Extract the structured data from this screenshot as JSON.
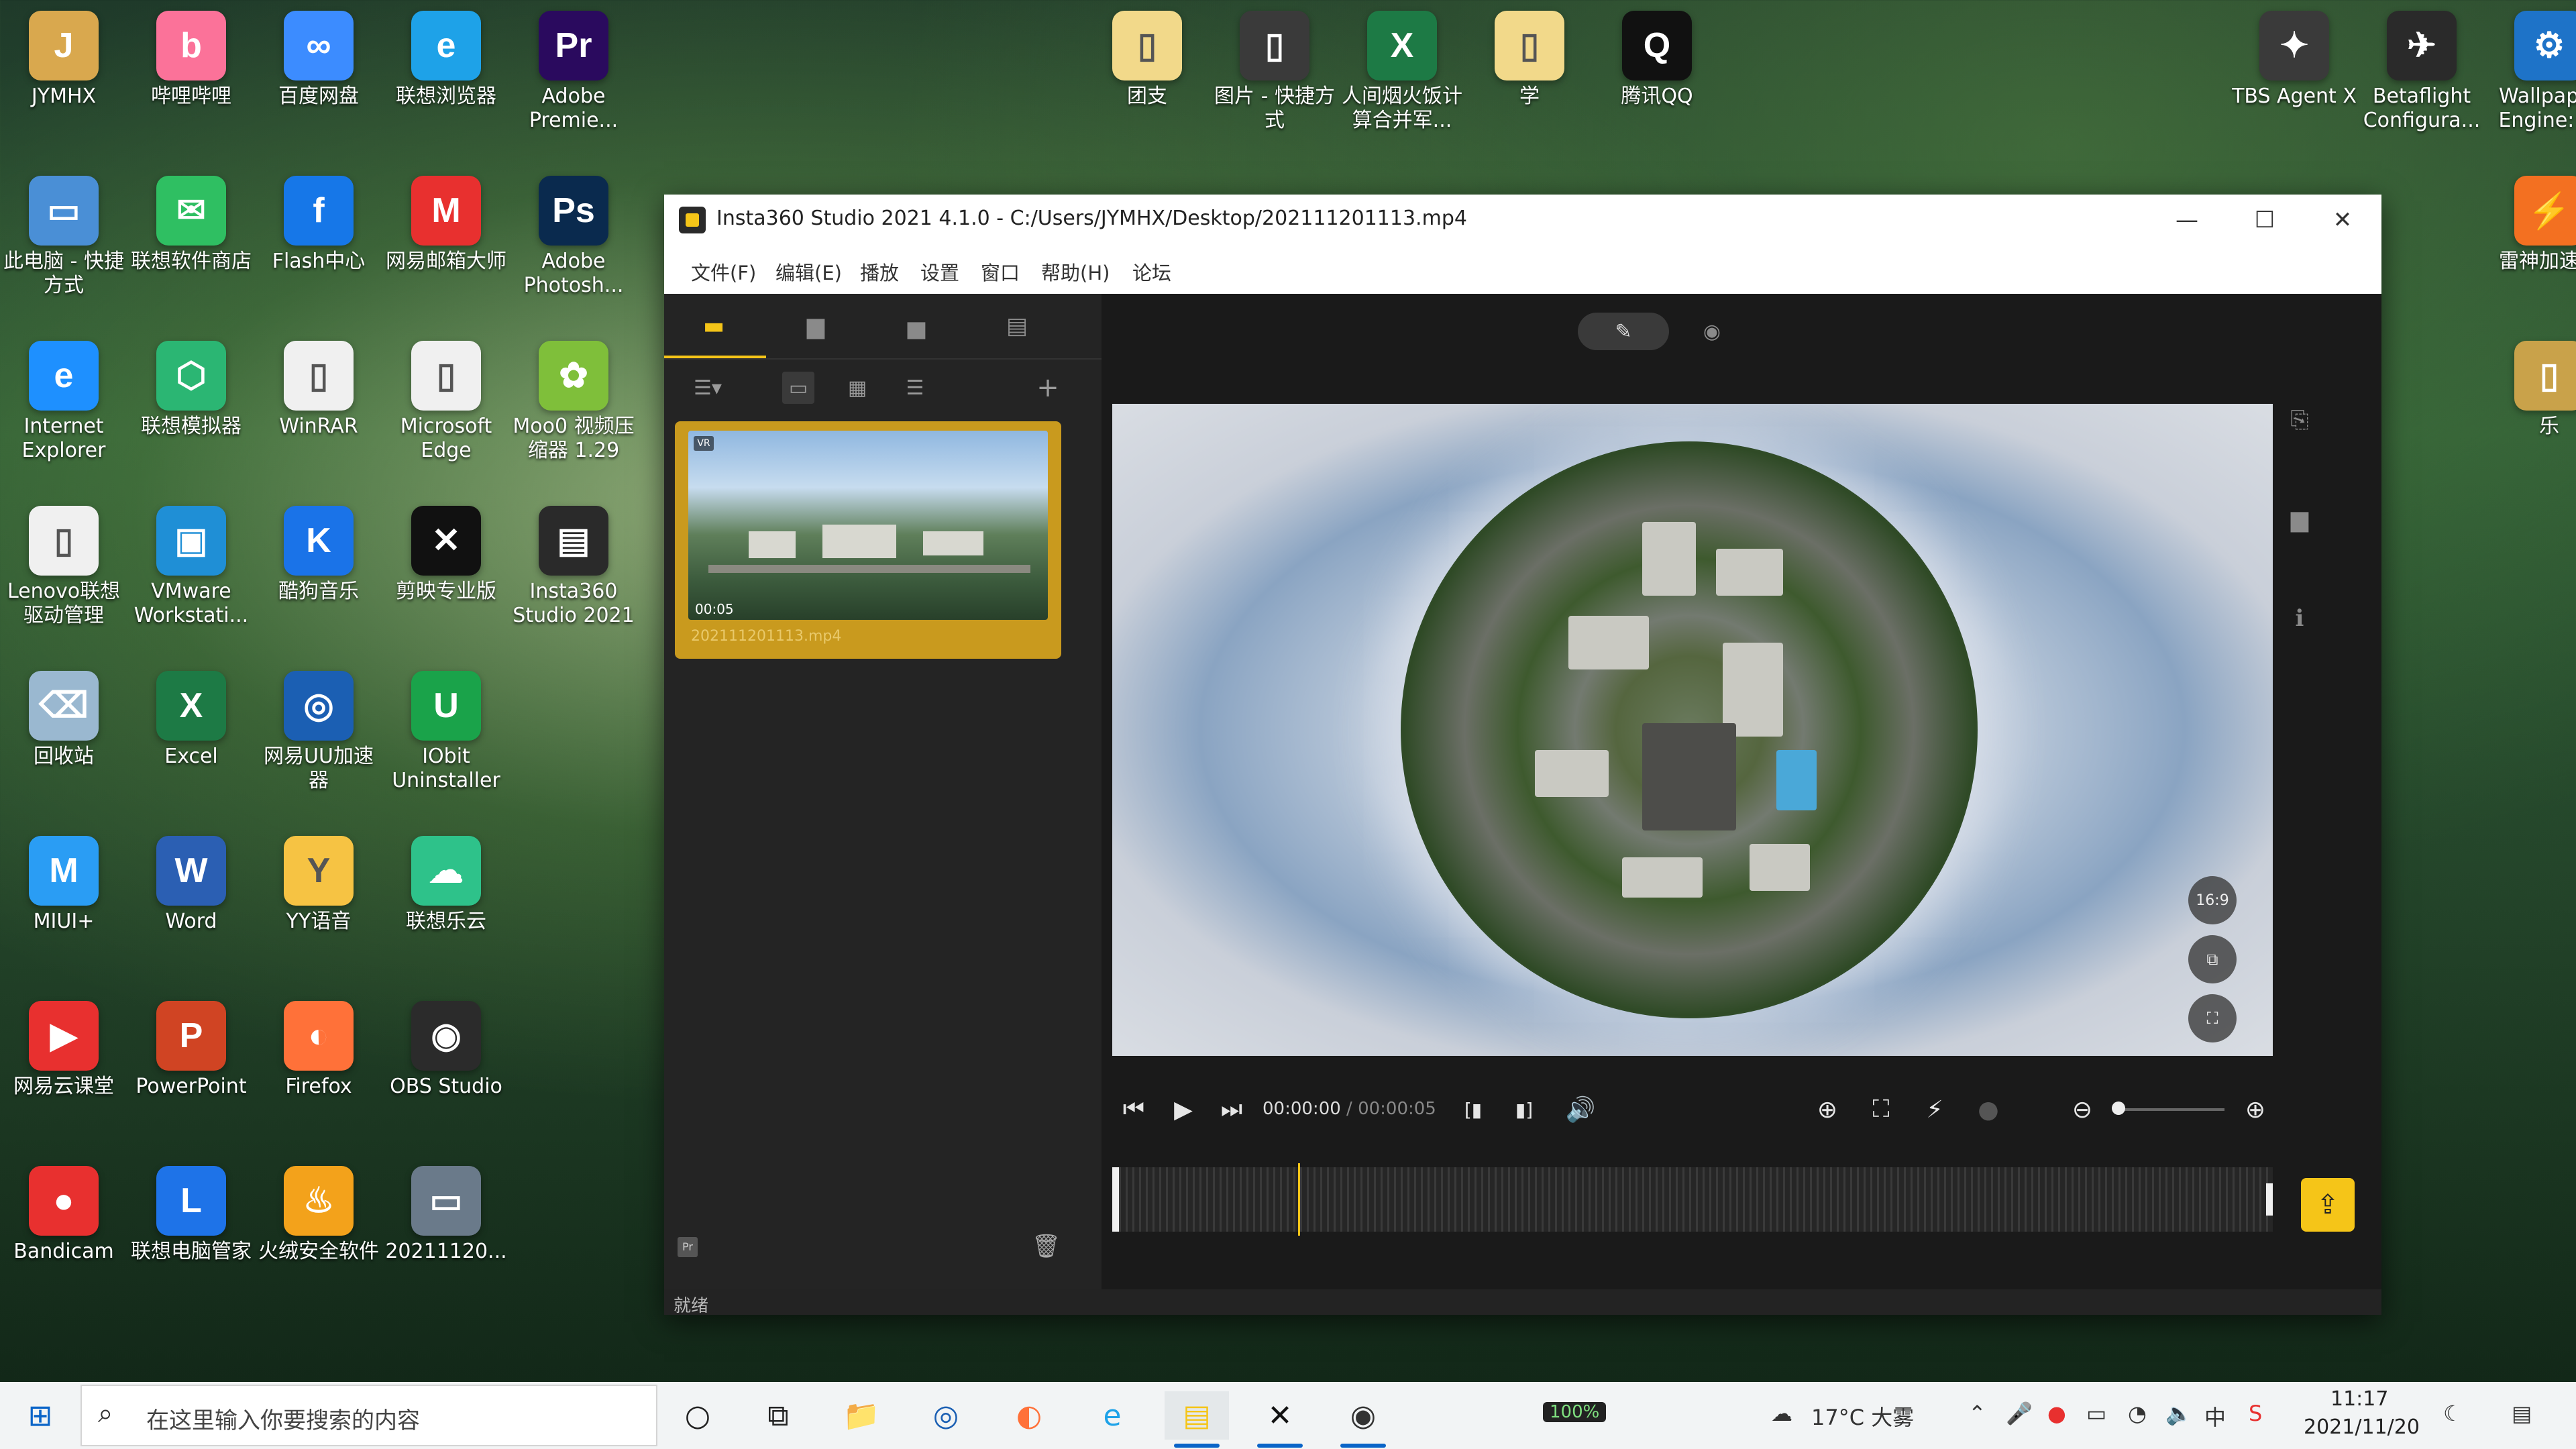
{
  "desktop": {
    "icons": [
      {
        "label": "JYMHX",
        "color": "#d9a84e",
        "glyph": "J"
      },
      {
        "label": "哔哩哔哩",
        "color": "#fb7299",
        "glyph": "b"
      },
      {
        "label": "百度网盘",
        "color": "#3c8cff",
        "glyph": "∞"
      },
      {
        "label": "联想浏览器",
        "color": "#1ea2e8",
        "glyph": "e"
      },
      {
        "label": "Adobe Premie...",
        "color": "#2a0a5e",
        "glyph": "Pr"
      },
      {
        "label": "此电脑 - 快捷方式",
        "color": "#4a8fd6",
        "glyph": "▭"
      },
      {
        "label": "联想软件商店",
        "color": "#2fbf62",
        "glyph": "✉"
      },
      {
        "label": "Flash中心",
        "color": "#1677e8",
        "glyph": "f"
      },
      {
        "label": "网易邮箱大师",
        "color": "#e8302f",
        "glyph": "M"
      },
      {
        "label": "Adobe Photosh...",
        "color": "#0a2a4e",
        "glyph": "Ps"
      },
      {
        "label": "Internet Explorer",
        "color": "#1e90ff",
        "glyph": "e"
      },
      {
        "label": "联想模拟器",
        "color": "#2bb673",
        "glyph": "⬡"
      },
      {
        "label": "WinRAR",
        "color": "#f0f0f0",
        "glyph": "▯"
      },
      {
        "label": "Microsoft Edge",
        "color": "#f0f0f0",
        "glyph": "▯"
      },
      {
        "label": "Moo0 视频压缩器 1.29",
        "color": "#7fbf3a",
        "glyph": "✿"
      },
      {
        "label": "Lenovo联想驱动管理",
        "color": "#f0f0f0",
        "glyph": "▯"
      },
      {
        "label": "VMware Workstati...",
        "color": "#1f8fd6",
        "glyph": "▣"
      },
      {
        "label": "酷狗音乐",
        "color": "#1a73e8",
        "glyph": "K"
      },
      {
        "label": "剪映专业版",
        "color": "#111111",
        "glyph": "✕"
      },
      {
        "label": "Insta360 Studio 2021",
        "color": "#2a2a2a",
        "glyph": "▤"
      },
      {
        "label": "回收站",
        "color": "#9ab8d0",
        "glyph": "⌫"
      },
      {
        "label": "Excel",
        "color": "#1d7a45",
        "glyph": "X"
      },
      {
        "label": "网易UU加速器",
        "color": "#1b5fb3",
        "glyph": "◎"
      },
      {
        "label": "IObit Uninstaller",
        "color": "#1aa34a",
        "glyph": "U"
      },
      {
        "label": "MIUI+",
        "color": "#2a9df4",
        "glyph": "M"
      },
      {
        "label": "Word",
        "color": "#2b5fb3",
        "glyph": "W"
      },
      {
        "label": "YY语音",
        "color": "#f6c343",
        "glyph": "Y"
      },
      {
        "label": "联想乐云",
        "color": "#2ec28a",
        "glyph": "☁"
      },
      {
        "label": "网易云课堂",
        "color": "#e8302f",
        "glyph": "▶"
      },
      {
        "label": "PowerPoint",
        "color": "#d04423",
        "glyph": "P"
      },
      {
        "label": "Firefox",
        "color": "#ff7139",
        "glyph": "◐"
      },
      {
        "label": "OBS Studio",
        "color": "#2b2b2b",
        "glyph": "◉"
      },
      {
        "label": "Bandicam",
        "color": "#e8302f",
        "glyph": "●"
      },
      {
        "label": "联想电脑管家",
        "color": "#1e73e8",
        "glyph": "L"
      },
      {
        "label": "火绒安全软件",
        "color": "#f3a21b",
        "glyph": "♨"
      },
      {
        "label": "20211120...",
        "color": "#6a7a8a",
        "glyph": "▭"
      },
      {
        "label": "团支",
        "color": "#f2d98a",
        "glyph": "▯"
      },
      {
        "label": "图片 - 快捷方式",
        "color": "#3a3a3a",
        "glyph": "▯"
      },
      {
        "label": "人间烟火饭计算合并军...",
        "color": "#1d7a45",
        "glyph": "X"
      },
      {
        "label": "学",
        "color": "#f2d98a",
        "glyph": "▯"
      },
      {
        "label": "腾讯QQ",
        "color": "#111111",
        "glyph": "Q"
      },
      {
        "label": "TBS Agent X",
        "color": "#3a3a3a",
        "glyph": "✦"
      },
      {
        "label": "Betaflight Configura...",
        "color": "#2a2a2a",
        "glyph": "✈"
      },
      {
        "label": "Wallpaper Engine: ...",
        "color": "#1e73c8",
        "glyph": "⚙"
      },
      {
        "label": "雷神加速器",
        "color": "#f37021",
        "glyph": "⚡"
      },
      {
        "label": "乐",
        "color": "#c9a24a",
        "glyph": "▯"
      }
    ]
  },
  "window": {
    "title": "Insta360 Studio 2021 4.1.0 - C:/Users/JYMHX/Desktop/202111201113.mp4",
    "controls": {
      "minimize": "—",
      "maximize": "☐",
      "close": "✕"
    },
    "menu": [
      "文件(F)",
      "编辑(E)",
      "播放",
      "设置",
      "窗口",
      "帮助(H)",
      "论坛"
    ],
    "status": "就绪"
  },
  "media_panel": {
    "tabs": [
      {
        "icon": "video-library-icon",
        "glyph": "▬"
      },
      {
        "icon": "file-icon",
        "glyph": "▆"
      },
      {
        "icon": "folder-icon",
        "glyph": "▅"
      },
      {
        "icon": "document-icon",
        "glyph": "▤"
      }
    ],
    "tools": {
      "sort": "☰▾",
      "grid_large": "▭",
      "grid_small": "▦",
      "list": "☰",
      "add": "+"
    },
    "clip": {
      "badge": "VR",
      "duration": "00:05",
      "filename": "202111201113.mp4"
    },
    "bottom_badge": "Pr",
    "trash": "🗑"
  },
  "preview": {
    "edit_glyph": "✎",
    "eye_glyph": "◉",
    "ratio_label": "16:9",
    "aspect_glyph": "⧉",
    "fullscreen_glyph": "⛶",
    "side_tools": [
      "⎘",
      "▆",
      "ℹ"
    ]
  },
  "playback": {
    "prev": "⏮",
    "play": "▶",
    "next": "⏭",
    "current_time": "00:00:00",
    "separator": " / ",
    "duration": "00:00:05",
    "trim_in": "[▮",
    "trim_out": "▮]",
    "volume": "🔊",
    "add_keyframe": "⊕",
    "snapshot": "⛶",
    "speed": "⚡",
    "mask": "●",
    "zoom_out": "⊖",
    "zoom_in": "⊕",
    "zoom_level": 0.05,
    "playhead_fraction": 0.16,
    "export_glyph": "⇪"
  },
  "taskbar": {
    "search_placeholder": "在这里输入你要搜索的内容",
    "apps": [
      "○",
      "⧉",
      "📁",
      "◎",
      "◐",
      "e",
      "▤",
      "✕",
      "◉"
    ],
    "battery": "100%",
    "weather": "17°C 大雾",
    "time": "11:17",
    "date": "2021/11/20"
  }
}
